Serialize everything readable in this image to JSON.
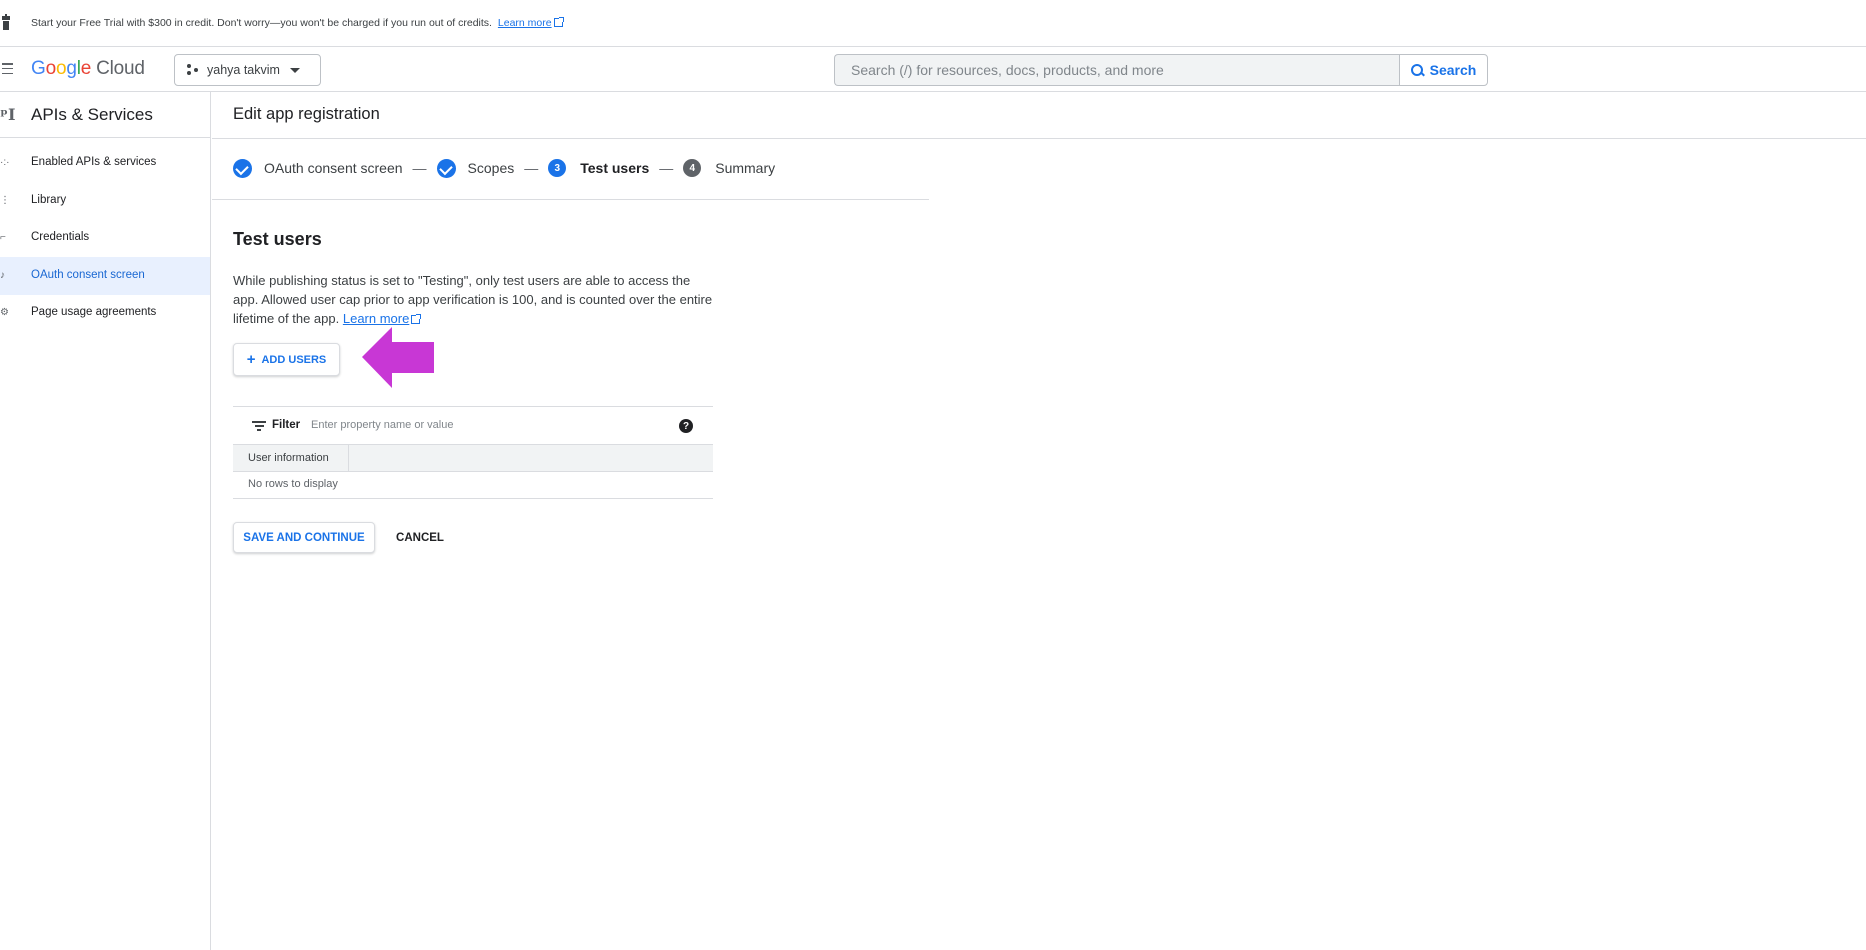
{
  "banner": {
    "text": "Start your Free Trial with $300 in credit. Don't worry—you won't be charged if you run out of credits.",
    "learn_more": "Learn more"
  },
  "header": {
    "logo_google": [
      "G",
      "o",
      "o",
      "g",
      "l",
      "e"
    ],
    "logo_cloud": "Cloud",
    "project_name": "yahya takvim",
    "search_placeholder": "Search (/) for resources, docs, products, and more",
    "search_button": "Search"
  },
  "sidebar": {
    "title": "APIs & Services",
    "items": [
      {
        "label": "Enabled APIs & services",
        "icon": "api-icon"
      },
      {
        "label": "Library",
        "icon": "library-icon"
      },
      {
        "label": "Credentials",
        "icon": "key-icon"
      },
      {
        "label": "OAuth consent screen",
        "icon": "consent-icon",
        "active": true
      },
      {
        "label": "Page usage agreements",
        "icon": "settings-icon"
      }
    ]
  },
  "main": {
    "page_title": "Edit app registration",
    "steps": [
      {
        "label": "OAuth consent screen",
        "state": "done"
      },
      {
        "label": "Scopes",
        "state": "done"
      },
      {
        "number": "3",
        "label": "Test users",
        "state": "current"
      },
      {
        "number": "4",
        "label": "Summary",
        "state": "upcoming"
      }
    ],
    "section_title": "Test users",
    "description": "While publishing status is set to \"Testing\", only test users are able to access the app. Allowed user cap prior to app verification is 100, and is counted over the entire lifetime of the app.",
    "learn_more": "Learn more",
    "add_users": "ADD USERS",
    "filter_label": "Filter",
    "filter_placeholder": "Enter property name or value",
    "help_icon": "?",
    "table_header": "User information",
    "empty_text": "No rows to display",
    "save_button": "SAVE AND CONTINUE",
    "cancel_button": "CANCEL"
  },
  "colors": {
    "accent": "#1a73e8",
    "arrow": "#c837d5",
    "active_bg": "#e8f0fe"
  }
}
